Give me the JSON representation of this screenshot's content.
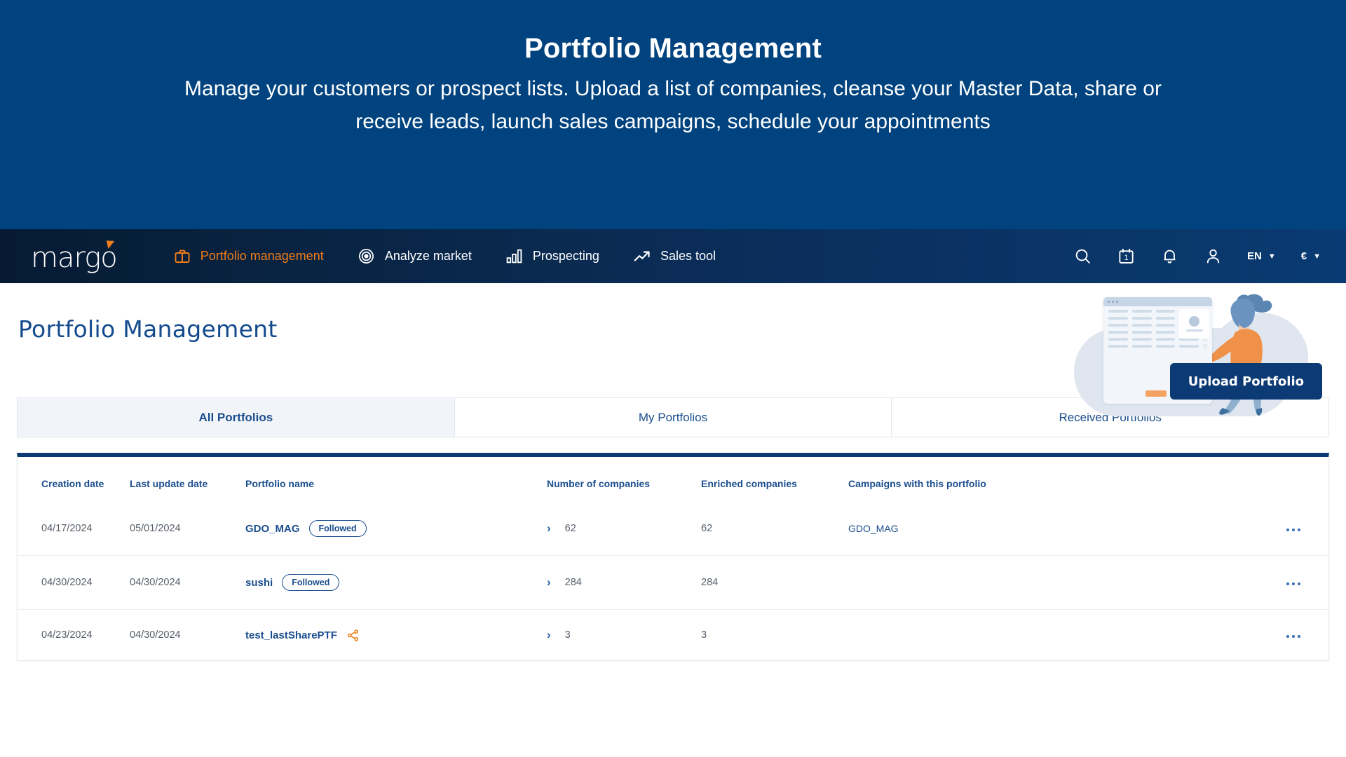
{
  "hero": {
    "title": "Portfolio Management",
    "subtitle": "Manage your customers or prospect lists. Upload a list of companies, cleanse your Master Data, share or receive leads, launch sales campaigns, schedule your appointments"
  },
  "navbar": {
    "logo_text": "margo",
    "items": [
      {
        "label": "Portfolio management",
        "icon": "briefcase-icon",
        "active": true
      },
      {
        "label": "Analyze market",
        "icon": "target-icon",
        "active": false
      },
      {
        "label": "Prospecting",
        "icon": "bar-chart-icon",
        "active": false
      },
      {
        "label": "Sales tool",
        "icon": "trending-up-icon",
        "active": false
      }
    ],
    "right": {
      "search_icon": "search-icon",
      "calendar_icon": "calendar-icon",
      "calendar_day": "1",
      "bell_icon": "bell-icon",
      "account_icon": "user-icon",
      "language": "EN",
      "language_caret": "▼",
      "currency": "€",
      "currency_caret": "▼"
    }
  },
  "page": {
    "title": "Portfolio Management",
    "upload_button": "Upload Portfolio",
    "search_button_icon": "search-icon"
  },
  "tabs": [
    {
      "label": "All Portfolios",
      "active": true
    },
    {
      "label": "My Portfolios",
      "active": false
    },
    {
      "label": "Received Portfolios",
      "active": false
    }
  ],
  "table": {
    "columns": [
      "Creation date",
      "Last update date",
      "Portfolio name",
      "Number of companies",
      "Enriched companies",
      "Campaigns with this portfolio"
    ],
    "rows": [
      {
        "creation_date": "04/17/2024",
        "last_update_date": "05/01/2024",
        "portfolio_name": "GDO_MAG",
        "badge": "Followed",
        "shared": false,
        "number_of_companies": "62",
        "enriched_companies": "62",
        "campaigns": "GDO_MAG"
      },
      {
        "creation_date": "04/30/2024",
        "last_update_date": "04/30/2024",
        "portfolio_name": "sushi",
        "badge": "Followed",
        "shared": false,
        "number_of_companies": "284",
        "enriched_companies": "284",
        "campaigns": ""
      },
      {
        "creation_date": "04/23/2024",
        "last_update_date": "04/30/2024",
        "portfolio_name": "test_lastSharePTF",
        "badge": "",
        "shared": true,
        "number_of_companies": "3",
        "enriched_companies": "3",
        "campaigns": ""
      }
    ]
  },
  "colors": {
    "brand_blue": "#01437f",
    "nav_dark": "#061a33",
    "accent_orange": "#ef7d1a",
    "link_blue": "#1b4e8e",
    "button_blue": "#0b3a74"
  }
}
